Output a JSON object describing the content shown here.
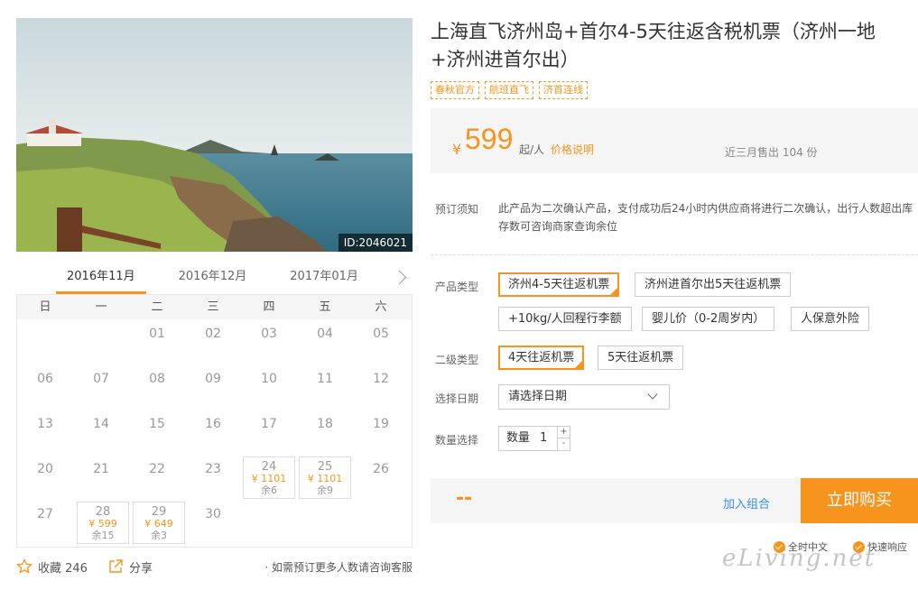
{
  "hero": {
    "image_id": "ID:2046021"
  },
  "calendar": {
    "months": [
      "2016年11月",
      "2016年12月",
      "2017年01月"
    ],
    "weekdays": [
      "日",
      "一",
      "二",
      "三",
      "四",
      "五",
      "六"
    ],
    "days": {
      "d01": "01",
      "d02": "02",
      "d03": "03",
      "d04": "04",
      "d05": "05",
      "d06": "06",
      "d07": "07",
      "d08": "08",
      "d09": "09",
      "d10": "10",
      "d11": "11",
      "d12": "12",
      "d13": "13",
      "d14": "14",
      "d15": "15",
      "d16": "16",
      "d17": "17",
      "d18": "18",
      "d19": "19",
      "d20": "20",
      "d21": "21",
      "d22": "22",
      "d23": "23",
      "d24": "24",
      "d25": "25",
      "d26": "26",
      "d27": "27",
      "d28": "28",
      "d29": "29",
      "d30": "30"
    },
    "avail": {
      "d24": {
        "price": "¥ 1101",
        "remain": "余6"
      },
      "d25": {
        "price": "¥ 1101",
        "remain": "余9"
      },
      "d28": {
        "price": "¥ 599",
        "remain": "余15"
      },
      "d29": {
        "price": "¥ 649",
        "remain": "余3"
      }
    }
  },
  "actions": {
    "favorite": "收藏 246",
    "share": "分享",
    "consult": "· 如需预订更多人数请咨询客服"
  },
  "product": {
    "title": "上海直飞济州岛+首尔4-5天往返含税机票（济州一地+济州进首尔出）",
    "tags": [
      "春秋官方",
      "航班直飞",
      "济首连线"
    ]
  },
  "price": {
    "currency": "¥",
    "amount": "599",
    "per": "起/人",
    "note": "价格说明",
    "sold": "近三月售出 104 份"
  },
  "notice": {
    "label": "预订须知",
    "text": "此产品为二次确认产品，支付成功后24小时内供应商将进行二次确认，出行人数超出库存数可咨询商家查询余位"
  },
  "options": {
    "type_label": "产品类型",
    "types": [
      "济州4-5天往返机票",
      "济州进首尔出5天往返机票",
      "+10kg/人回程行李额",
      "婴儿价（0-2周岁内）",
      "人保意外险"
    ],
    "sub_label": "二级类型",
    "subs": [
      "4天往返机票",
      "5天往返机票"
    ],
    "date_label": "选择日期",
    "date_placeholder": "请选择日期",
    "qty_label": "数量选择",
    "qty_text": "数量",
    "qty_value": "1",
    "plus": "+",
    "minus": "-"
  },
  "buy": {
    "total": "--",
    "add_combo": "加入组合",
    "buy_now": "立即购买"
  },
  "badges": [
    "全时中文",
    "快速响应"
  ],
  "watermark": "eLiving.net",
  "colors": {
    "accent": "#f7941d",
    "link": "#3a8ee6",
    "panel": "#f5f5f5"
  }
}
